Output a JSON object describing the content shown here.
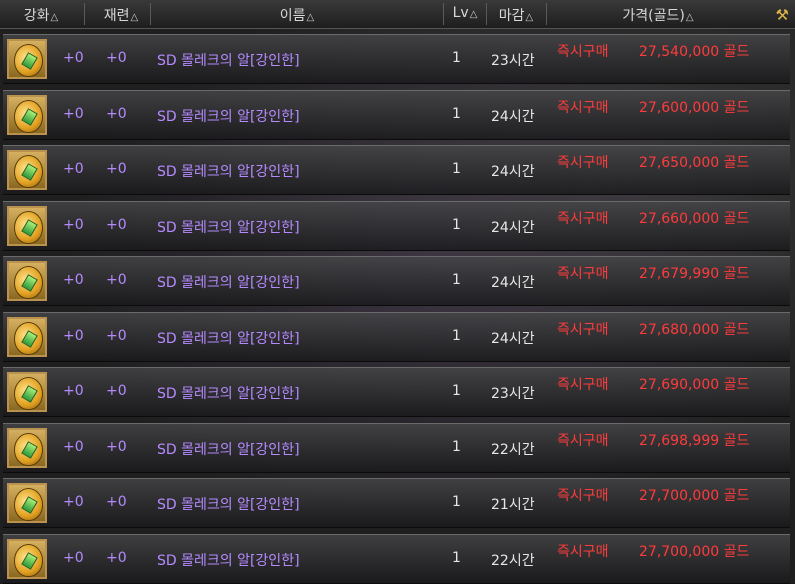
{
  "header": {
    "col_enhance": "강화",
    "col_refine": "재련",
    "col_name": "이름",
    "col_level": "Lv",
    "col_deadline": "마감",
    "col_price": "가격(골드)"
  },
  "listings": [
    {
      "enhance": "+0",
      "refine": "+0",
      "name": "SD 몰레크의 알[강인한]",
      "level": "1",
      "time": "23시간",
      "buy": "즉시구매",
      "price": "27,540,000",
      "unit": "골드"
    },
    {
      "enhance": "+0",
      "refine": "+0",
      "name": "SD 몰레크의 알[강인한]",
      "level": "1",
      "time": "24시간",
      "buy": "즉시구매",
      "price": "27,600,000",
      "unit": "골드"
    },
    {
      "enhance": "+0",
      "refine": "+0",
      "name": "SD 몰레크의 알[강인한]",
      "level": "1",
      "time": "24시간",
      "buy": "즉시구매",
      "price": "27,650,000",
      "unit": "골드"
    },
    {
      "enhance": "+0",
      "refine": "+0",
      "name": "SD 몰레크의 알[강인한]",
      "level": "1",
      "time": "24시간",
      "buy": "즉시구매",
      "price": "27,660,000",
      "unit": "골드"
    },
    {
      "enhance": "+0",
      "refine": "+0",
      "name": "SD 몰레크의 알[강인한]",
      "level": "1",
      "time": "24시간",
      "buy": "즉시구매",
      "price": "27,679,990",
      "unit": "골드"
    },
    {
      "enhance": "+0",
      "refine": "+0",
      "name": "SD 몰레크의 알[강인한]",
      "level": "1",
      "time": "24시간",
      "buy": "즉시구매",
      "price": "27,680,000",
      "unit": "골드"
    },
    {
      "enhance": "+0",
      "refine": "+0",
      "name": "SD 몰레크의 알[강인한]",
      "level": "1",
      "time": "23시간",
      "buy": "즉시구매",
      "price": "27,690,000",
      "unit": "골드"
    },
    {
      "enhance": "+0",
      "refine": "+0",
      "name": "SD 몰레크의 알[강인한]",
      "level": "1",
      "time": "22시간",
      "buy": "즉시구매",
      "price": "27,698,999",
      "unit": "골드"
    },
    {
      "enhance": "+0",
      "refine": "+0",
      "name": "SD 몰레크의 알[강인한]",
      "level": "1",
      "time": "21시간",
      "buy": "즉시구매",
      "price": "27,700,000",
      "unit": "골드"
    },
    {
      "enhance": "+0",
      "refine": "+0",
      "name": "SD 몰레크의 알[강인한]",
      "level": "1",
      "time": "22시간",
      "buy": "즉시구매",
      "price": "27,700,000",
      "unit": "골드"
    }
  ],
  "colors": {
    "purple": "#b58aff",
    "red": "#ff3b3b",
    "text": "#e6e6e6"
  }
}
